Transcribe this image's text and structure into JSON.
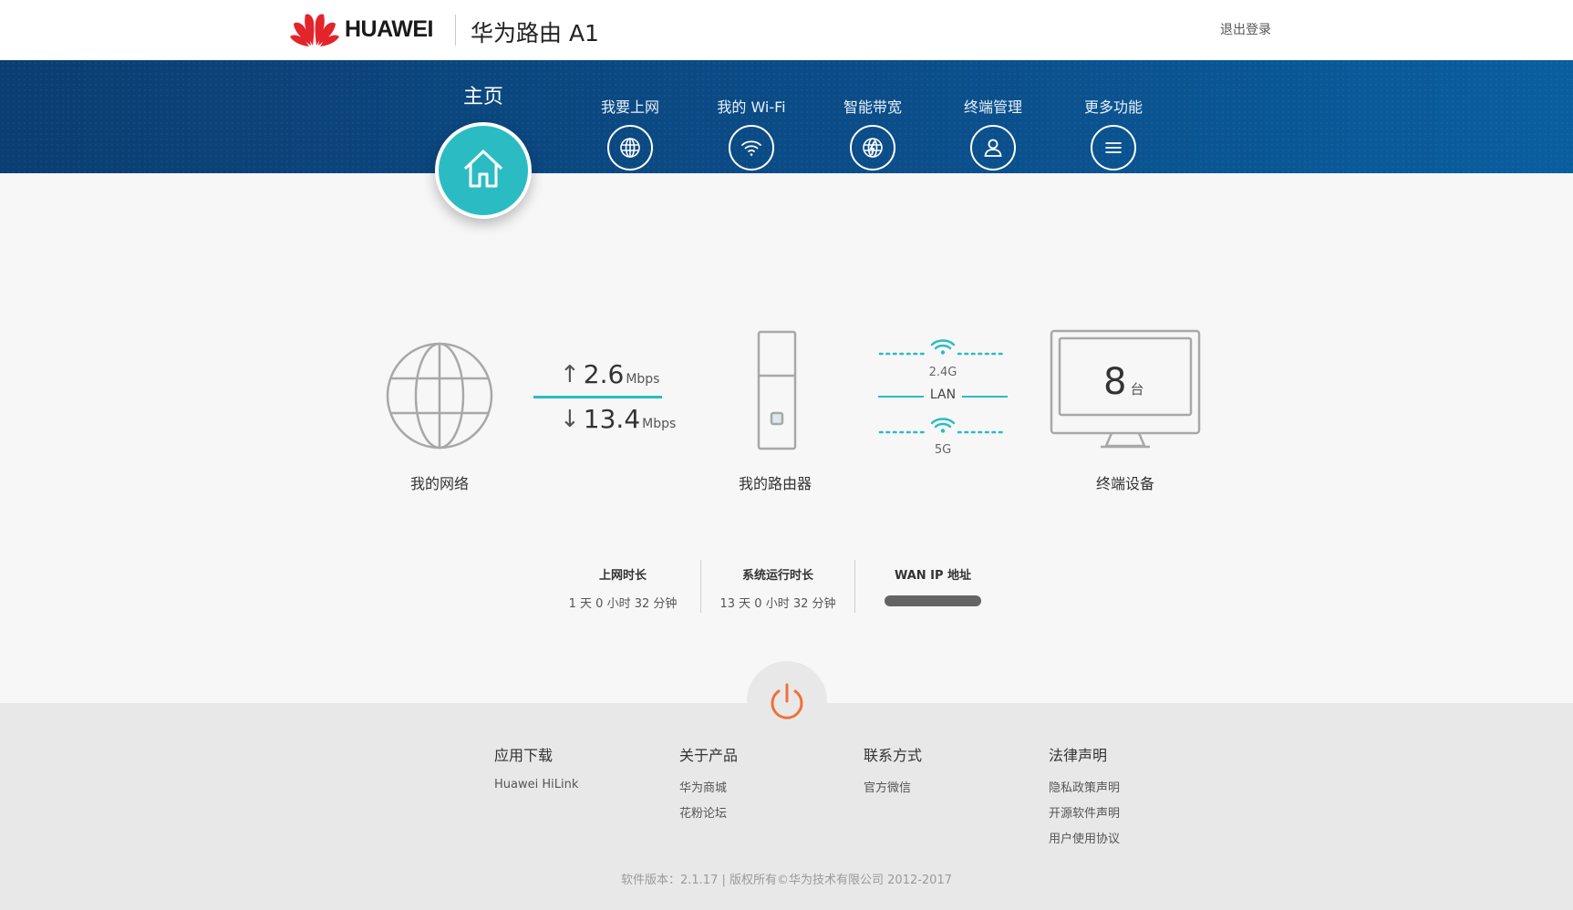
{
  "header": {
    "brand": "HUAWEI",
    "product": "华为路由 A1",
    "logout": "退出登录"
  },
  "nav": {
    "home": "主页",
    "items": [
      {
        "label": "我要上网",
        "icon": "globe-icon"
      },
      {
        "label": "我的 Wi-Fi",
        "icon": "wifi-icon"
      },
      {
        "label": "智能带宽",
        "icon": "smart-bandwidth-icon"
      },
      {
        "label": "终端管理",
        "icon": "user-icon"
      },
      {
        "label": "更多功能",
        "icon": "menu-icon"
      }
    ]
  },
  "main": {
    "network_label": "我的网络",
    "upload": {
      "value": "2.6",
      "unit": "Mbps"
    },
    "download": {
      "value": "13.4",
      "unit": "Mbps"
    },
    "router_label": "我的路由器",
    "band_24": "2.4G",
    "lan": "LAN",
    "band_5": "5G",
    "device_count": "8",
    "device_unit": "台",
    "devices_label": "终端设备"
  },
  "stats": {
    "online_key": "上网时长",
    "online_value": "1 天 0 小时 32 分钟",
    "uptime_key": "系统运行时长",
    "uptime_value": "13 天 0 小时 32 分钟",
    "wan_key": "WAN IP 地址"
  },
  "footer": {
    "col1": {
      "title": "应用下载",
      "links": [
        "Huawei HiLink"
      ]
    },
    "col2": {
      "title": "关于产品",
      "links": [
        "华为商城",
        "花粉论坛"
      ]
    },
    "col3": {
      "title": "联系方式",
      "links": [
        "官方微信"
      ]
    },
    "col4": {
      "title": "法律声明",
      "links": [
        "隐私政策声明",
        "开源软件声明",
        "用户使用协议"
      ]
    },
    "copyright": "软件版本：2.1.17 | 版权所有©华为技术有限公司 2012-2017"
  },
  "colors": {
    "accent": "#2bbcc3",
    "nav_dark": "#0b3e72",
    "power": "#f0703a",
    "brand_red": "#e3242b"
  }
}
